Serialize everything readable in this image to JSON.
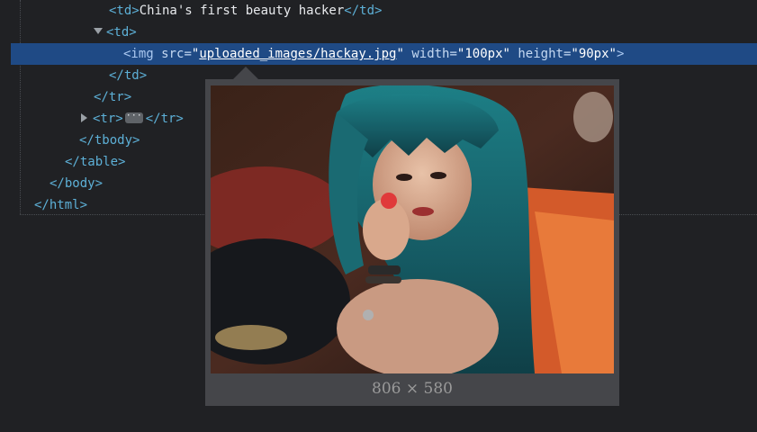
{
  "dom_tree": {
    "td_open": "<td>",
    "td_text": "China's first beauty hacker",
    "td_close": "</td>",
    "img_open": "<img",
    "src_attr": "src=",
    "quote": "\"",
    "src_value": "uploaded_images/hackay.jpg",
    "width_attr": "width=",
    "width_value": "\"100px\"",
    "height_attr": "height=",
    "height_value": "\"90px\"",
    "img_end": ">",
    "tr_close": "</tr>",
    "tr_open": "<tr>",
    "ellipsis": "···",
    "tbody_close": "</tbody>",
    "table_close": "</table>",
    "body_close": "</body>",
    "html_close": "</html>"
  },
  "image_preview": {
    "dimensions": "806 × 580"
  },
  "colors": {
    "background": "#202124",
    "selection": "#1f4a85",
    "tag": "#5db0d7",
    "attribute_value": "#f29766",
    "tooltip_bg": "#45464a"
  }
}
